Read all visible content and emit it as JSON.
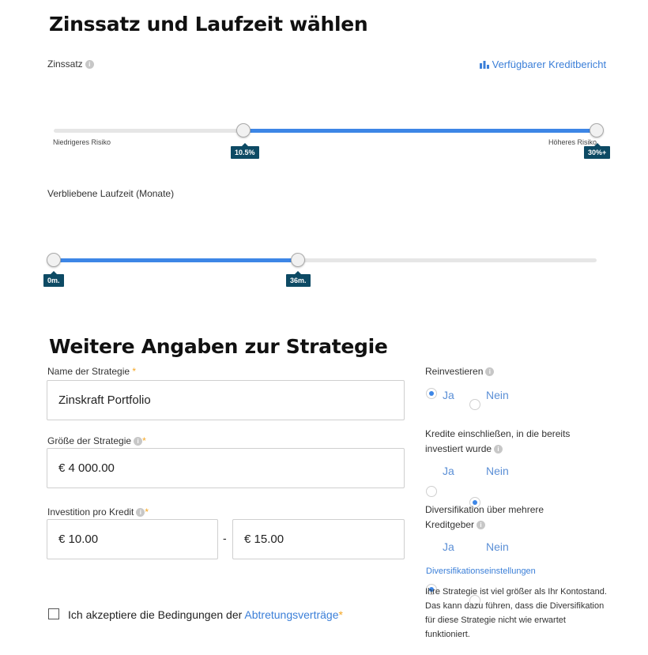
{
  "section1": {
    "title": "Zinssatz und Laufzeit wählen",
    "rate": {
      "label": "Zinssatz",
      "credit_report_link": "Verfügbarer Kreditbericht",
      "low_label": "Niedrigeres Risiko",
      "high_label": "Höheres Risiko",
      "min_badge": "10.5%",
      "max_badge": "30%+"
    },
    "term": {
      "label": "Verbliebene Laufzeit (Monate)",
      "min_badge": "0m.",
      "max_badge": "36m."
    }
  },
  "section2": {
    "title": "Weitere Angaben zur Strategie",
    "name": {
      "label": "Name der Strategie",
      "value": "Zinskraft Portfolio"
    },
    "size": {
      "label": "Größe der Strategie",
      "value": "€ 4 000.00"
    },
    "per_loan": {
      "label": "Investition pro Kredit",
      "min_value": "€ 10.00",
      "separator": "-",
      "max_value": "€ 15.00"
    },
    "required_mark": "*",
    "reinvest": {
      "label": "Reinvestieren",
      "yes": "Ja",
      "no": "Nein",
      "selected": "yes"
    },
    "include": {
      "label_line1": "Kredite einschließen, in die bereits",
      "label_line2": "investiert wurde",
      "yes": "Ja",
      "no": "Nein",
      "selected": "no"
    },
    "diversify": {
      "label_line1": "Diversifikation über mehrere",
      "label_line2": "Kreditgeber",
      "yes": "Ja",
      "no": "Nein",
      "selected": "yes"
    },
    "diversify_settings_link": "Diversifikationseinstellungen",
    "warning": [
      "Ihre Strategie ist viel größer als Ihr Kontostand.",
      "Das kann dazu führen, dass die Diversifikation",
      "für diese Strategie nicht wie erwartet",
      "funktioniert."
    ],
    "terms": {
      "text": "Ich akzeptiere die Bedingungen der",
      "link": "Abtretungsverträge",
      "required": "*"
    }
  },
  "icons": {
    "info": "info-icon",
    "chart": "bar-chart-icon"
  },
  "colors": {
    "accent": "#3d86e6",
    "badge": "#0d4a64",
    "link": "#3b7fd8",
    "required": "#f5a623"
  }
}
